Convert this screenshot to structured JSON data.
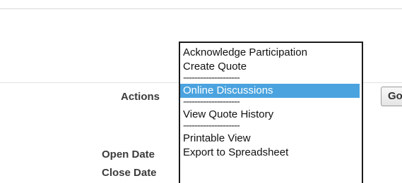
{
  "fields": {
    "actions_label": "Actions",
    "open_date_label": "Open Date",
    "close_date_label": "Close Date"
  },
  "actions_dropdown": {
    "options": [
      "Acknowledge Participation",
      "Create Quote",
      "--------------------",
      "Online Discussions",
      "--------------------",
      "View Quote History",
      "--------------------",
      "Printable View",
      "Export to Spreadsheet"
    ],
    "selected": "Online Discussions"
  },
  "go_button": {
    "label": "Go"
  },
  "colors": {
    "selected_bg": "#4aa3df",
    "border": "#1a1a1a"
  }
}
